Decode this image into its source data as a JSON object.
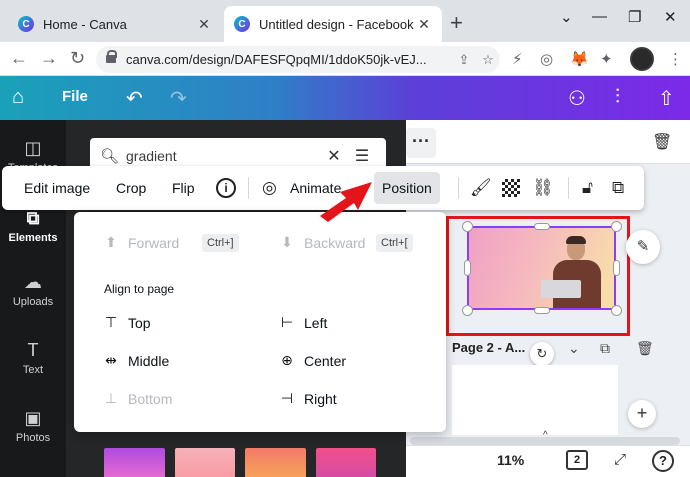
{
  "browser": {
    "tabs": [
      {
        "title": "Home - Canva",
        "active": false
      },
      {
        "title": "Untitled design - Facebook Co",
        "active": true
      }
    ],
    "url": "canva.com/design/DAFESFQpqMI/1ddoK50jk-vEJ..."
  },
  "header": {
    "file_label": "File"
  },
  "rail": {
    "items": [
      {
        "label": "Templates",
        "icon": "templates-icon"
      },
      {
        "label": "Elements",
        "icon": "elements-icon"
      },
      {
        "label": "Uploads",
        "icon": "uploads-icon"
      },
      {
        "label": "Text",
        "icon": "text-icon"
      },
      {
        "label": "Photos",
        "icon": "photos-icon"
      }
    ]
  },
  "search": {
    "value": "gradient"
  },
  "toolbar": {
    "edit_image": "Edit image",
    "crop": "Crop",
    "flip": "Flip",
    "animate": "Animate",
    "position": "Position"
  },
  "position_menu": {
    "forward": "Forward",
    "forward_shortcut": "Ctrl+]",
    "backward": "Backward",
    "backward_shortcut": "Ctrl+[",
    "section_title": "Align to page",
    "top": "Top",
    "middle": "Middle",
    "bottom": "Bottom",
    "left": "Left",
    "center": "Center",
    "right": "Right"
  },
  "canvas": {
    "page_label": "Page 2 - A...",
    "zoom": "11%",
    "page_count": "2",
    "help": "?"
  },
  "colors": {
    "highlight": "#e3151a",
    "selection": "#8b3dff",
    "header_start": "#1aa1b9",
    "header_end": "#7c2ae8"
  }
}
